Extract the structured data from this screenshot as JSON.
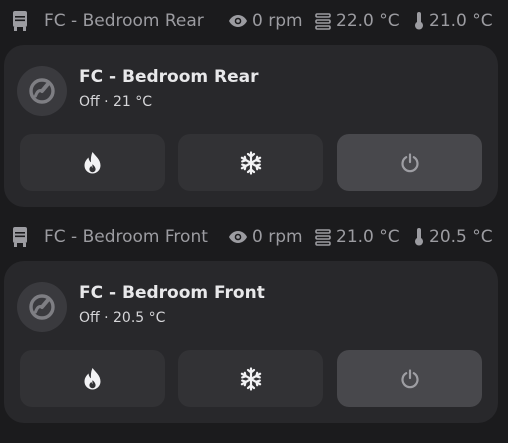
{
  "units": [
    {
      "name": "FC - Bedroom Rear",
      "fan_speed": "0 rpm",
      "setpoint": "22.0 °C",
      "temperature": "21.0 °C",
      "card": {
        "title": "FC - Bedroom Rear",
        "state": "Off · 21 °C",
        "modes": [
          {
            "mode": "heat",
            "icon": "fire-icon"
          },
          {
            "mode": "cool",
            "icon": "snowflake-icon"
          },
          {
            "mode": "off",
            "icon": "power-icon",
            "active": true
          }
        ]
      }
    },
    {
      "name": "FC - Bedroom Front",
      "fan_speed": "0 rpm",
      "setpoint": "21.0 °C",
      "temperature": "20.5 °C",
      "card": {
        "title": "FC - Bedroom Front",
        "state": "Off · 20.5 °C",
        "modes": [
          {
            "mode": "heat",
            "icon": "fire-icon"
          },
          {
            "mode": "cool",
            "icon": "snowflake-icon"
          },
          {
            "mode": "off",
            "icon": "power-icon",
            "active": true
          }
        ]
      }
    }
  ],
  "colors": {
    "background": "#1b1b1d",
    "card": "#28282b",
    "button": "#323235",
    "button_active": "#48484c",
    "status_text": "#9c9ca1",
    "title_text": "#e8e8ea",
    "icon": "#f2f2f4",
    "icon_muted": "#9e9ea3"
  }
}
